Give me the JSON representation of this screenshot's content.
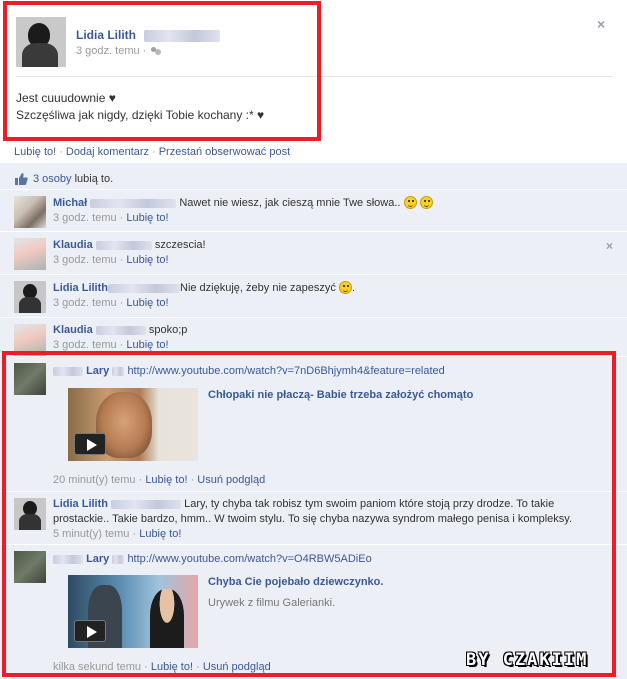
{
  "post": {
    "author": "Lidia Lilith",
    "time": "3 godz. temu",
    "separator": "·",
    "close_glyph": "×",
    "text_line1": "Jest cuuudownie ♥",
    "text_line2": "Szczęśliwa jak nigdy, dzięki Tobie kochany :* ♥"
  },
  "actions": {
    "like": "Lubię to!",
    "comment": "Dodaj komentarz",
    "unfollow": "Przestań obserwować post",
    "sep": "·"
  },
  "likes": {
    "count_link": "3 osoby",
    "suffix": "lubią to."
  },
  "comments": [
    {
      "name": "Michał",
      "text": "Nawet nie wiesz, jak cieszą mnie Twe słowa..",
      "time": "3 godz. temu",
      "like": "Lubię to!"
    },
    {
      "name": "Klaudia",
      "text": "szczescia!",
      "time": "3 godz. temu",
      "like": "Lubię to!",
      "close": "×"
    },
    {
      "name": "Lidia Lilith",
      "text": "Nie dziękuję, żeby nie zapeszyć",
      "suffix": ".",
      "time": "3 godz. temu",
      "like": "Lubię to!"
    },
    {
      "name": "Klaudia",
      "text": "spoko;p",
      "time": "3 godz. temu",
      "like": "Lubię to!"
    },
    {
      "name": "Lary",
      "url": "http://www.youtube.com/watch?v=7nD6Bhjymh4&feature=related",
      "video_title": "Chłopaki nie płaczą- Babie trzeba założyć chomąto",
      "time": "20 minut(y) temu",
      "like": "Lubię to!",
      "remove": "Usuń podgląd"
    },
    {
      "name": "Lidia Lilith",
      "text_line1": "Lary, ty chyba tak robisz tym swoim paniom które stoją przy drodze. To takie",
      "text_line2": "prostackie.. Takie bardzo, hmm.. W twoim stylu. To się chyba nazywa syndrom małego penisa i kompleksy.",
      "time": "5 minut(y) temu",
      "like": "Lubię to!"
    },
    {
      "name": "Lary",
      "url": "http://www.youtube.com/watch?v=O4RBW5ADiEo",
      "video_title": "Chyba Cie pojebało dziewczynko.",
      "video_desc": "Urywek z filmu Galerianki.",
      "time": "kilka sekund temu",
      "like": "Lubię to!",
      "remove": "Usuń podgląd"
    }
  ],
  "watermark": "BY CZAKIIM",
  "colors": {
    "link": "#3b5998",
    "feedback_bg": "#eceff5",
    "highlight": "#ee1c24"
  },
  "icons": [
    "friends-icon",
    "close-icon",
    "thumbs-up-icon",
    "smiley-icon",
    "play-icon"
  ]
}
